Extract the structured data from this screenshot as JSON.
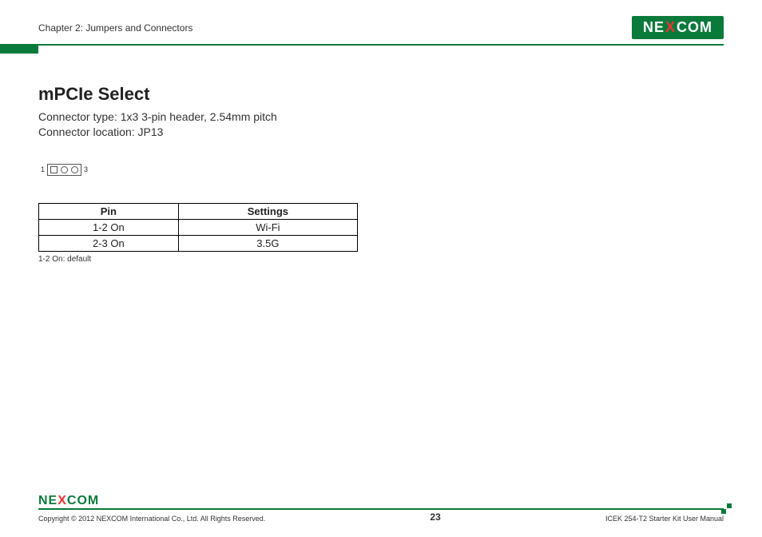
{
  "header": {
    "chapter": "Chapter 2: Jumpers and Connectors",
    "brand_pre": "NE",
    "brand_x": "X",
    "brand_post": "COM"
  },
  "section": {
    "title": "mPCIe Select",
    "line1": "Connector type: 1x3 3-pin header, 2.54mm pitch",
    "line2": "Connector location: JP13"
  },
  "jumper": {
    "left": "1",
    "right": "3"
  },
  "table": {
    "col1": "Pin",
    "col2": "Settings",
    "r1c1": "1-2 On",
    "r1c2": "Wi-Fi",
    "r2c1": "2-3 On",
    "r2c2": "3.5G",
    "note": "1-2 On: default"
  },
  "footer": {
    "copyright": "Copyright © 2012 NEXCOM International Co., Ltd. All Rights Reserved.",
    "page": "23",
    "manual": "ICEK 254-T2 Starter Kit User Manual"
  }
}
